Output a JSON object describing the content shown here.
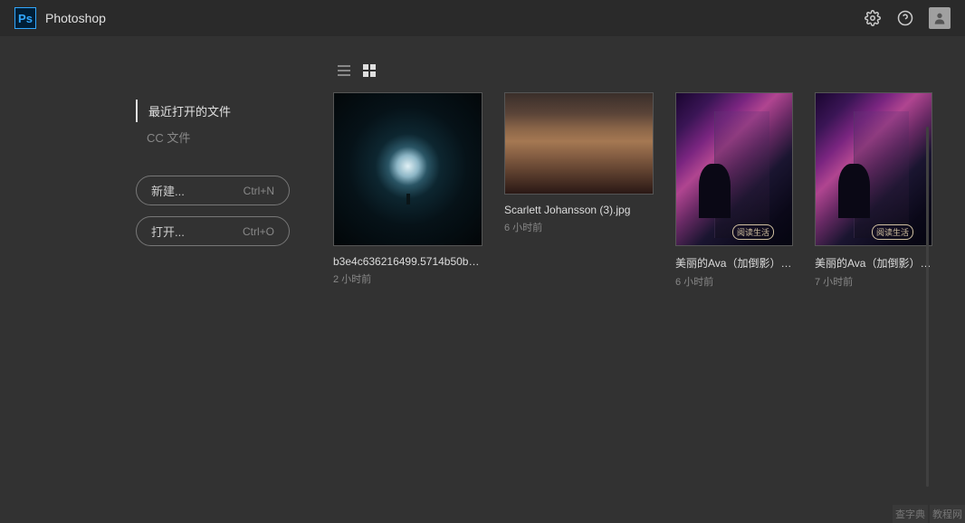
{
  "header": {
    "appName": "Photoshop",
    "logoText": "Ps"
  },
  "sidebar": {
    "tabs": {
      "recent": "最近打开的文件",
      "ccFiles": "CC 文件"
    },
    "buttons": {
      "new": {
        "label": "新建...",
        "shortcut": "Ctrl+N"
      },
      "open": {
        "label": "打开...",
        "shortcut": "Ctrl+O"
      }
    }
  },
  "files": [
    {
      "name": "b3e4c636216499.5714b50b9...",
      "time": "2 小时前"
    },
    {
      "name": "Scarlett Johansson (3).jpg",
      "time": "6 小时前"
    },
    {
      "name": "美丽的Ava（加倒影）.jpg",
      "time": "6 小时前"
    },
    {
      "name": "美丽的Ava（加倒影）.psd",
      "time": "7 小时前"
    }
  ],
  "thumbnailBadge": "阅读生活",
  "watermark": {
    "text1": "查字典",
    "text2": "教程网"
  }
}
